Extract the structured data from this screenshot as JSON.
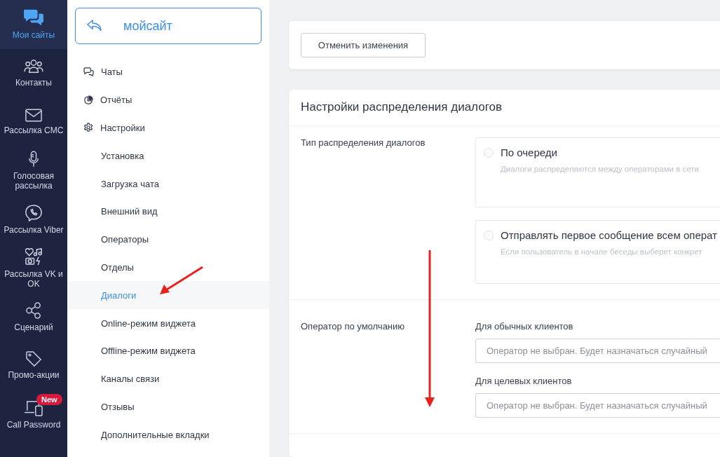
{
  "nav": [
    {
      "label": "Мои сайты",
      "selected": true
    },
    {
      "label": "Контакты",
      "selected": false
    },
    {
      "label": "Рассылка СМС",
      "selected": false
    },
    {
      "label": "Голосовая рассылка",
      "selected": false
    },
    {
      "label": "Рассылка Viber",
      "selected": false
    },
    {
      "label": "Рассылка VK и OK",
      "selected": false
    },
    {
      "label": "Сценарий",
      "selected": false
    },
    {
      "label": "Промо-акции",
      "selected": false
    },
    {
      "label": "Call Password",
      "selected": false,
      "badge": "New"
    }
  ],
  "site": {
    "name": "мойсайт"
  },
  "menu": [
    {
      "label": "Чаты"
    },
    {
      "label": "Отчёты"
    },
    {
      "label": "Настройки",
      "children": [
        {
          "label": "Установка",
          "selected": false
        },
        {
          "label": "Загрузка чата",
          "selected": false
        },
        {
          "label": "Внешний вид",
          "selected": false
        },
        {
          "label": "Операторы",
          "selected": false
        },
        {
          "label": "Отделы",
          "selected": false
        },
        {
          "label": "Диалоги",
          "selected": true
        },
        {
          "label": "Online-режим виджета",
          "selected": false
        },
        {
          "label": "Offline-режим виджета",
          "selected": false
        },
        {
          "label": "Каналы связи",
          "selected": false
        },
        {
          "label": "Отзывы",
          "selected": false
        },
        {
          "label": "Дополнительные вкладки",
          "selected": false
        }
      ]
    }
  ],
  "cancel_button": "Отменить изменения",
  "section": {
    "title": "Настройки распределения диалогов",
    "rows": [
      {
        "label": "Тип распределения диалогов",
        "kind": "radio",
        "options": [
          {
            "title": "По очереди",
            "description": "Диалоги распределяются между операторами в сети",
            "selected": false
          },
          {
            "title": "Отправлять первое сообщение всем операт",
            "description": "Если пользователь в начале беседы выберет конкрет",
            "selected": false
          }
        ]
      },
      {
        "label": "Оператор по умолчанию",
        "kind": "selects",
        "fields": [
          {
            "label": "Для обычных клиентов",
            "placeholder": "Оператор не выбран. Будет назначаться случайный"
          },
          {
            "label": "Для целевых клиентов",
            "placeholder": "Оператор не выбран. Будет назначаться случайный"
          }
        ]
      }
    ]
  }
}
